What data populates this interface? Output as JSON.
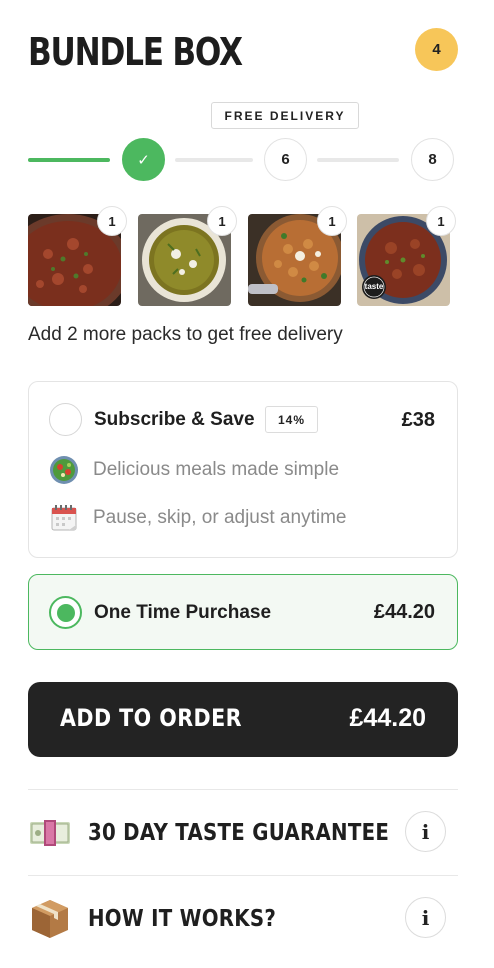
{
  "header": {
    "title": "BUNDLE BOX",
    "item_count": "4"
  },
  "free_delivery_label": "FREE DELIVERY",
  "progress": {
    "filled_fraction": 0.5,
    "steps": [
      "✓",
      "6",
      "8"
    ],
    "accent": "#4cb85f"
  },
  "items": [
    {
      "qty": "1",
      "image": "beef-chilli-dish"
    },
    {
      "qty": "1",
      "image": "spinach-curry-dish"
    },
    {
      "qty": "1",
      "image": "chickpea-masala-dish"
    },
    {
      "qty": "1",
      "image": "beef-ragu-dish",
      "badge": "taste"
    }
  ],
  "hint": "Add 2 more packs to get free delivery",
  "subscribe": {
    "label": "Subscribe & Save",
    "discount": "14%",
    "price": "£38",
    "selected": false,
    "features": [
      {
        "icon": "salad-bowl-icon",
        "text": "Delicious meals made simple"
      },
      {
        "icon": "calendar-icon",
        "text": "Pause, skip, or adjust anytime"
      }
    ]
  },
  "one_time": {
    "label": "One Time Purchase",
    "price": "£44.20",
    "selected": true
  },
  "cta": {
    "label": "ADD TO ORDER",
    "price": "£44.20"
  },
  "info_rows": [
    {
      "icon": "money-icon",
      "label": "30 DAY TASTE GUARANTEE",
      "button": "i"
    },
    {
      "icon": "package-icon",
      "label": "HOW IT WORKS?",
      "button": "i"
    }
  ],
  "colors": {
    "brand_yellow": "#f7c659",
    "green": "#4cb85f",
    "dark": "#232323"
  }
}
